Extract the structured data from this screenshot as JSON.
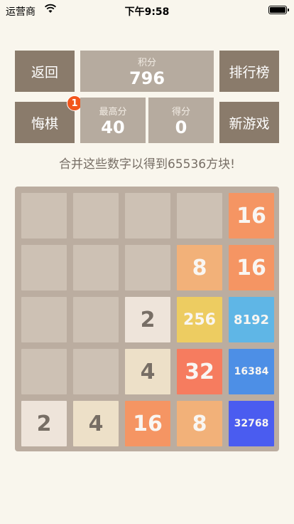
{
  "status_bar": {
    "carrier": "运营商",
    "time": "下午9:58"
  },
  "buttons": {
    "back": "返回",
    "leaderboard": "排行榜",
    "undo": "悔棋",
    "new_game": "新游戏"
  },
  "undo_badge": "1",
  "scores": {
    "total_label": "积分",
    "total_value": "796",
    "best_label": "最高分",
    "best_value": "40",
    "current_label": "得分",
    "current_value": "0"
  },
  "slogan": "合并这些数字以得到65536方块!",
  "board": {
    "rows": [
      [
        "",
        "",
        "",
        "",
        "16"
      ],
      [
        "",
        "",
        "",
        "8",
        "16"
      ],
      [
        "",
        "",
        "2",
        "256",
        "8192"
      ],
      [
        "",
        "",
        "4",
        "32",
        "16384"
      ],
      [
        "2",
        "4",
        "16",
        "8",
        "32768"
      ]
    ]
  },
  "colors": {
    "empty": "#cdc1b4",
    "2": "#eee4da",
    "4": "#ede0c8",
    "8": "#f2b179",
    "16": "#f59563",
    "32": "#f67c5f",
    "256": "#edcc61",
    "8192": "#5fb6e6",
    "16384": "#4d8fe6",
    "32768": "#4a5cf0"
  }
}
